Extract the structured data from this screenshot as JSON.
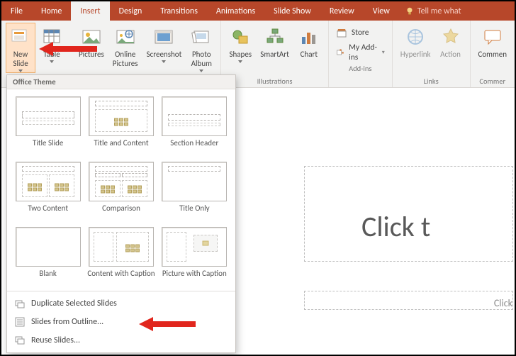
{
  "menubar": {
    "tabs": [
      "File",
      "Home",
      "Insert",
      "Design",
      "Transitions",
      "Animations",
      "Slide Show",
      "Review",
      "View"
    ],
    "tell": "Tell me what"
  },
  "ribbon": {
    "new_slide": "New\nSlide",
    "table": "Table",
    "pictures": "Pictures",
    "online_pictures": "Online\nPictures",
    "screenshot": "Screenshot",
    "photo_album": "Photo\nAlbum",
    "shapes": "Shapes",
    "smartart": "SmartArt",
    "chart": "Chart",
    "store": "Store",
    "my_addins": "My Add-ins",
    "hyperlink": "Hyperlink",
    "action": "Action",
    "comment": "Commen",
    "groups": {
      "illus": "Illustrations",
      "addins": "Add-ins",
      "links": "Links",
      "comments": "Commer"
    }
  },
  "gallery": {
    "header": "Office Theme",
    "layouts": [
      "Title Slide",
      "Title and Content",
      "Section Header",
      "Two Content",
      "Comparison",
      "Title Only",
      "Blank",
      "Content with Caption",
      "Picture with Caption"
    ],
    "menu": {
      "dup": "Duplicate Selected Slides",
      "outline": "Slides from Outline...",
      "reuse": "Reuse Slides..."
    }
  },
  "slide": {
    "title": "Click t",
    "subtitle": "Click"
  }
}
